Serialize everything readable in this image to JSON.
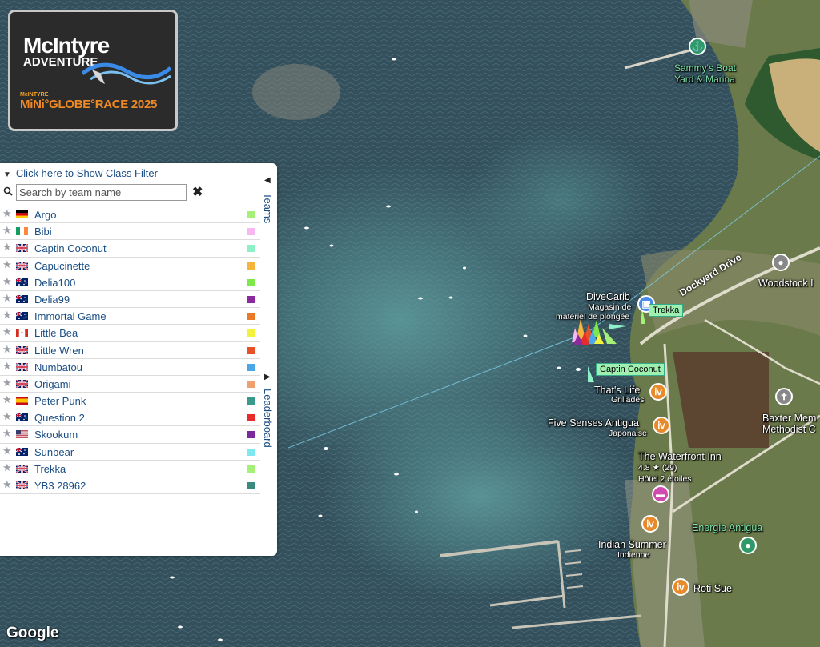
{
  "logo": {
    "line1": "McIntyre",
    "line2": "ADVENTURE",
    "line3": "McINTYRE",
    "line4": "MiNi°GLOBE°RACE 2025"
  },
  "panel": {
    "filter_label": "Click here to Show Class Filter",
    "search_placeholder": "Search by team name",
    "tabs": {
      "teams": "Teams",
      "leaderboard": "Leaderboard"
    },
    "teams": [
      {
        "name": "Argo",
        "flag": "de",
        "color": "#a6f07a"
      },
      {
        "name": "Bibi",
        "flag": "ie",
        "color": "#f7b7f0"
      },
      {
        "name": "Captin Coconut",
        "flag": "gb",
        "color": "#8ff0c8"
      },
      {
        "name": "Capucinette",
        "flag": "gb",
        "color": "#f5b43c"
      },
      {
        "name": "Delia100",
        "flag": "au",
        "color": "#7ee84a"
      },
      {
        "name": "Delia99",
        "flag": "au",
        "color": "#8a2a9c"
      },
      {
        "name": "Immortal Game",
        "flag": "au",
        "color": "#e87a2a"
      },
      {
        "name": "Little Bea",
        "flag": "ca",
        "color": "#f2f23c"
      },
      {
        "name": "Little Wren",
        "flag": "gb",
        "color": "#e8502a"
      },
      {
        "name": "Numbatou",
        "flag": "gb",
        "color": "#4aa8e8"
      },
      {
        "name": "Origami",
        "flag": "gb",
        "color": "#f0a070"
      },
      {
        "name": "Peter Punk",
        "flag": "es",
        "color": "#3a9a8a"
      },
      {
        "name": "Question 2",
        "flag": "au",
        "color": "#e82a2a"
      },
      {
        "name": "Skookum",
        "flag": "us",
        "color": "#7a2a9c"
      },
      {
        "name": "Sunbear",
        "flag": "au",
        "color": "#7ee8f0"
      },
      {
        "name": "Trekka",
        "flag": "gb",
        "color": "#a6f07a"
      },
      {
        "name": "YB3 28962",
        "flag": "gb",
        "color": "#3a8a80"
      }
    ]
  },
  "map": {
    "places": {
      "sammys": "Sammy's Boat\nYard & Marina",
      "divecarib": "DiveCarib",
      "divecarib_sub1": "Magasin de",
      "divecarib_sub2": "matériel de plongée",
      "woodstock": "Woodstock I",
      "thats_life": "That's Life",
      "thats_life_sub": "Grillades",
      "five_senses": "Five Senses Antigua",
      "five_senses_sub": "Japonaise",
      "waterfront": "The Waterfront Inn",
      "waterfront_rating": "4.8 ★ (29)",
      "waterfront_sub": "Hôtel 2 étoiles",
      "baxter1": "Baxter Mem",
      "baxter2": "Methodist C",
      "energie": "Energie Antigua",
      "indian": "Indian Summer",
      "indian_sub": "Indienne",
      "roti": "Roti Sue"
    },
    "road": "Dockyard Drive",
    "boat_tags": {
      "trekka": "Trekka",
      "captin": "Captin Coconut"
    },
    "attribution": "Google"
  }
}
